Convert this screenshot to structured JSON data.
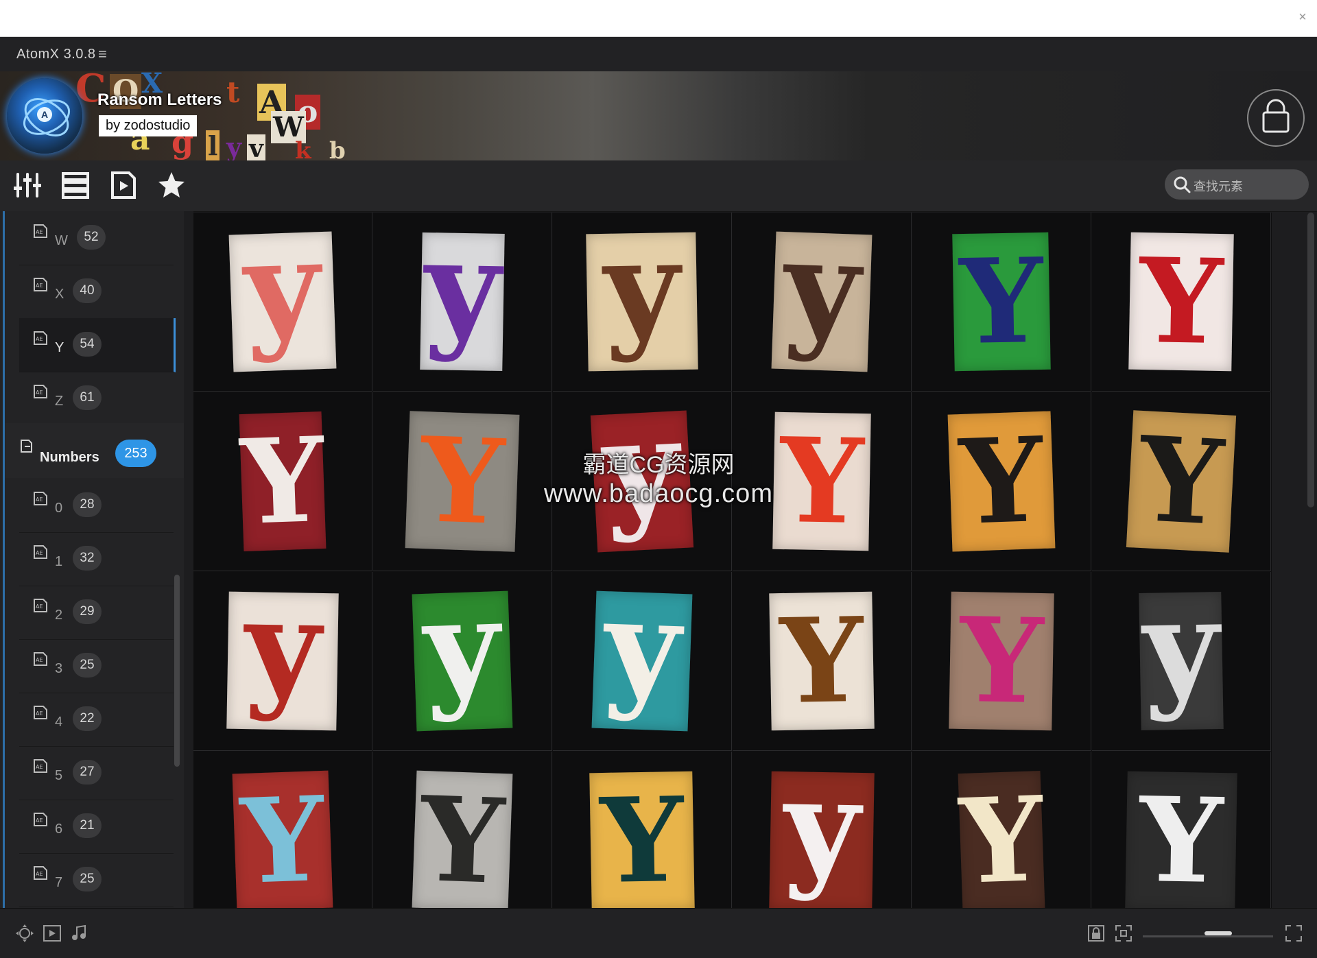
{
  "app": {
    "title": "AtomX 3.0.8",
    "close_glyph": "×",
    "menu_glyph": "≡"
  },
  "banner": {
    "pack_title": "Ransom Letters",
    "author": "by zodostudio"
  },
  "search": {
    "placeholder": "查找元素"
  },
  "sidebar": {
    "items_top": [
      {
        "label": "W",
        "count": "52"
      },
      {
        "label": "X",
        "count": "40"
      },
      {
        "label": "Y",
        "count": "54",
        "active": true
      },
      {
        "label": "Z",
        "count": "61"
      }
    ],
    "category": {
      "label": "Numbers",
      "count": "253"
    },
    "items_bottom": [
      {
        "label": "0",
        "count": "28"
      },
      {
        "label": "1",
        "count": "32"
      },
      {
        "label": "2",
        "count": "29"
      },
      {
        "label": "3",
        "count": "25"
      },
      {
        "label": "4",
        "count": "22"
      },
      {
        "label": "5",
        "count": "27"
      },
      {
        "label": "6",
        "count": "21"
      },
      {
        "label": "7",
        "count": "25"
      }
    ]
  },
  "grid": {
    "tiles": [
      {
        "glyph": "y",
        "paper": "#ece4dc",
        "ink": "#e06a63"
      },
      {
        "glyph": "y",
        "paper": "#d9d9db",
        "ink": "#6a2fa0"
      },
      {
        "glyph": "y",
        "paper": "#e4cfa8",
        "ink": "#6a3a22"
      },
      {
        "glyph": "y",
        "paper": "#c8b49a",
        "ink": "#4a2e22"
      },
      {
        "glyph": "Y",
        "paper": "#2a9a3c",
        "ink": "#1f2a78"
      },
      {
        "glyph": "Y",
        "paper": "#f1e7e4",
        "ink": "#c41a22"
      },
      {
        "glyph": "Y",
        "paper": "#8f2028",
        "ink": "#f0eae6"
      },
      {
        "glyph": "Y",
        "paper": "#8e8a82",
        "ink": "#ee5a1c"
      },
      {
        "glyph": "y",
        "paper": "#9a2226",
        "ink": "#efe6e8"
      },
      {
        "glyph": "Y",
        "paper": "#eadbd0",
        "ink": "#e43a22"
      },
      {
        "glyph": "Y",
        "paper": "#e09a3a",
        "ink": "#1e1a18"
      },
      {
        "glyph": "Y",
        "paper": "#c79a52",
        "ink": "#1b1a18"
      },
      {
        "glyph": "y",
        "paper": "#ebe1d8",
        "ink": "#b42a22"
      },
      {
        "glyph": "y",
        "paper": "#2c8a2e",
        "ink": "#f0f0ee"
      },
      {
        "glyph": "y",
        "paper": "#2e9aa0",
        "ink": "#f3efe6"
      },
      {
        "glyph": "Y",
        "paper": "#ece2d6",
        "ink": "#7a4416"
      },
      {
        "glyph": "Y",
        "paper": "#a0806e",
        "ink": "#c82878"
      },
      {
        "glyph": "y",
        "paper": "#3a3a3a",
        "ink": "#dcdcdc"
      },
      {
        "glyph": "Y",
        "paper": "#a8302c",
        "ink": "#7cc0d8"
      },
      {
        "glyph": "Y",
        "paper": "#b8b6b2",
        "ink": "#2a2a28"
      },
      {
        "glyph": "Y",
        "paper": "#e8b44a",
        "ink": "#0f3a3a"
      },
      {
        "glyph": "y",
        "paper": "#8c2b20",
        "ink": "#f4f0f0"
      },
      {
        "glyph": "Y",
        "paper": "#4a2c22",
        "ink": "#f2e6c8"
      },
      {
        "glyph": "Y",
        "paper": "#2c2c2c",
        "ink": "#eeeeee"
      }
    ]
  },
  "watermark": {
    "line1": "霸道CG资源网",
    "line2": "www.badaocg.com"
  }
}
